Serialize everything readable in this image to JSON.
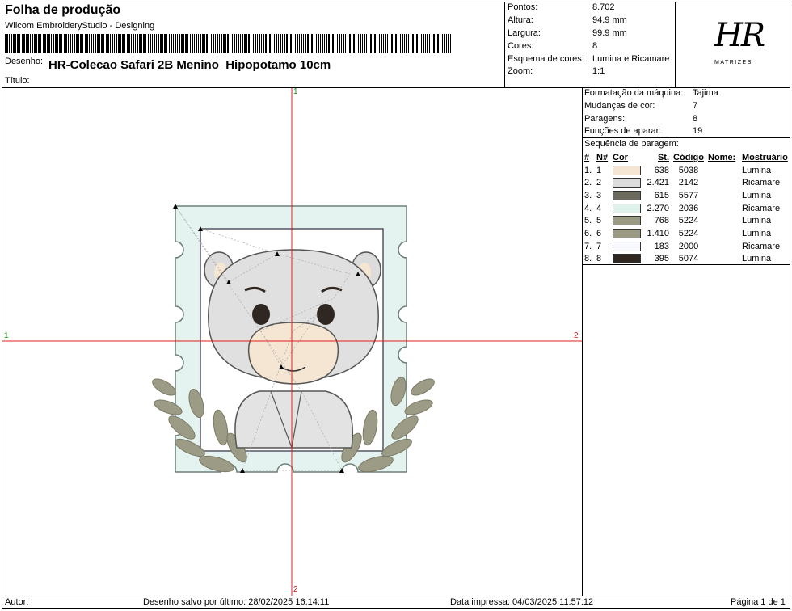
{
  "header": {
    "title": "Folha de produção",
    "software": "Wilcom EmbroideryStudio - Designing",
    "design_label": "Desenho:",
    "design_name": "HR-Colecao Safari 2B Menino_Hipopotamo 10cm",
    "title_label": "Título:"
  },
  "stats": [
    {
      "label": "Pontos:",
      "value": "8.702"
    },
    {
      "label": "Altura:",
      "value": "94.9 mm"
    },
    {
      "label": "Largura:",
      "value": "99.9 mm"
    },
    {
      "label": "Cores:",
      "value": "8"
    },
    {
      "label": "Esquema de cores:",
      "value": "Lumina e Ricamare"
    },
    {
      "label": "Zoom:",
      "value": "1:1"
    }
  ],
  "logo": {
    "text": "HR",
    "sub": "MATRIZES"
  },
  "machine": [
    {
      "label": "Formatação da máquina:",
      "value": "Tajima"
    },
    {
      "label": "Mudanças de cor:",
      "value": "7"
    },
    {
      "label": "Paragens:",
      "value": "8"
    },
    {
      "label": "Funções de aparar:",
      "value": "19"
    }
  ],
  "sequence": {
    "title": "Sequência de paragem:",
    "columns": [
      "#",
      "N#",
      "Cor",
      "St.",
      "Código",
      "Nome:",
      "Mostruário"
    ],
    "rows": [
      {
        "idx": "1.",
        "n": "1",
        "color": "#f5e6d3",
        "st": "638",
        "code": "5038",
        "name": "",
        "chart": "Lumina"
      },
      {
        "idx": "2.",
        "n": "2",
        "color": "#dcdcdc",
        "st": "2.421",
        "code": "2142",
        "name": "",
        "chart": "Ricamare"
      },
      {
        "idx": "3.",
        "n": "3",
        "color": "#6b6a5c",
        "st": "615",
        "code": "5577",
        "name": "",
        "chart": "Lumina"
      },
      {
        "idx": "4.",
        "n": "4",
        "color": "#dff2ec",
        "st": "2.270",
        "code": "2036",
        "name": "",
        "chart": "Ricamare"
      },
      {
        "idx": "5.",
        "n": "5",
        "color": "#9a9a84",
        "st": "768",
        "code": "5224",
        "name": "",
        "chart": "Lumina"
      },
      {
        "idx": "6.",
        "n": "6",
        "color": "#9a9a84",
        "st": "1.410",
        "code": "5224",
        "name": "",
        "chart": "Lumina"
      },
      {
        "idx": "7.",
        "n": "7",
        "color": "#f7f9ff",
        "st": "183",
        "code": "2000",
        "name": "",
        "chart": "Ricamare"
      },
      {
        "idx": "8.",
        "n": "8",
        "color": "#2e2722",
        "st": "395",
        "code": "5074",
        "name": "",
        "chart": "Lumina"
      }
    ]
  },
  "axis_labels": {
    "top": "1",
    "left": "1",
    "right": "2",
    "bottom": "2"
  },
  "footer": {
    "author_label": "Autor:",
    "saved": "Desenho salvo por último: 28/02/2025 16:14:11",
    "printed": "Data impressa: 04/03/2025 11:57:12",
    "page": "Página 1 de 1"
  }
}
